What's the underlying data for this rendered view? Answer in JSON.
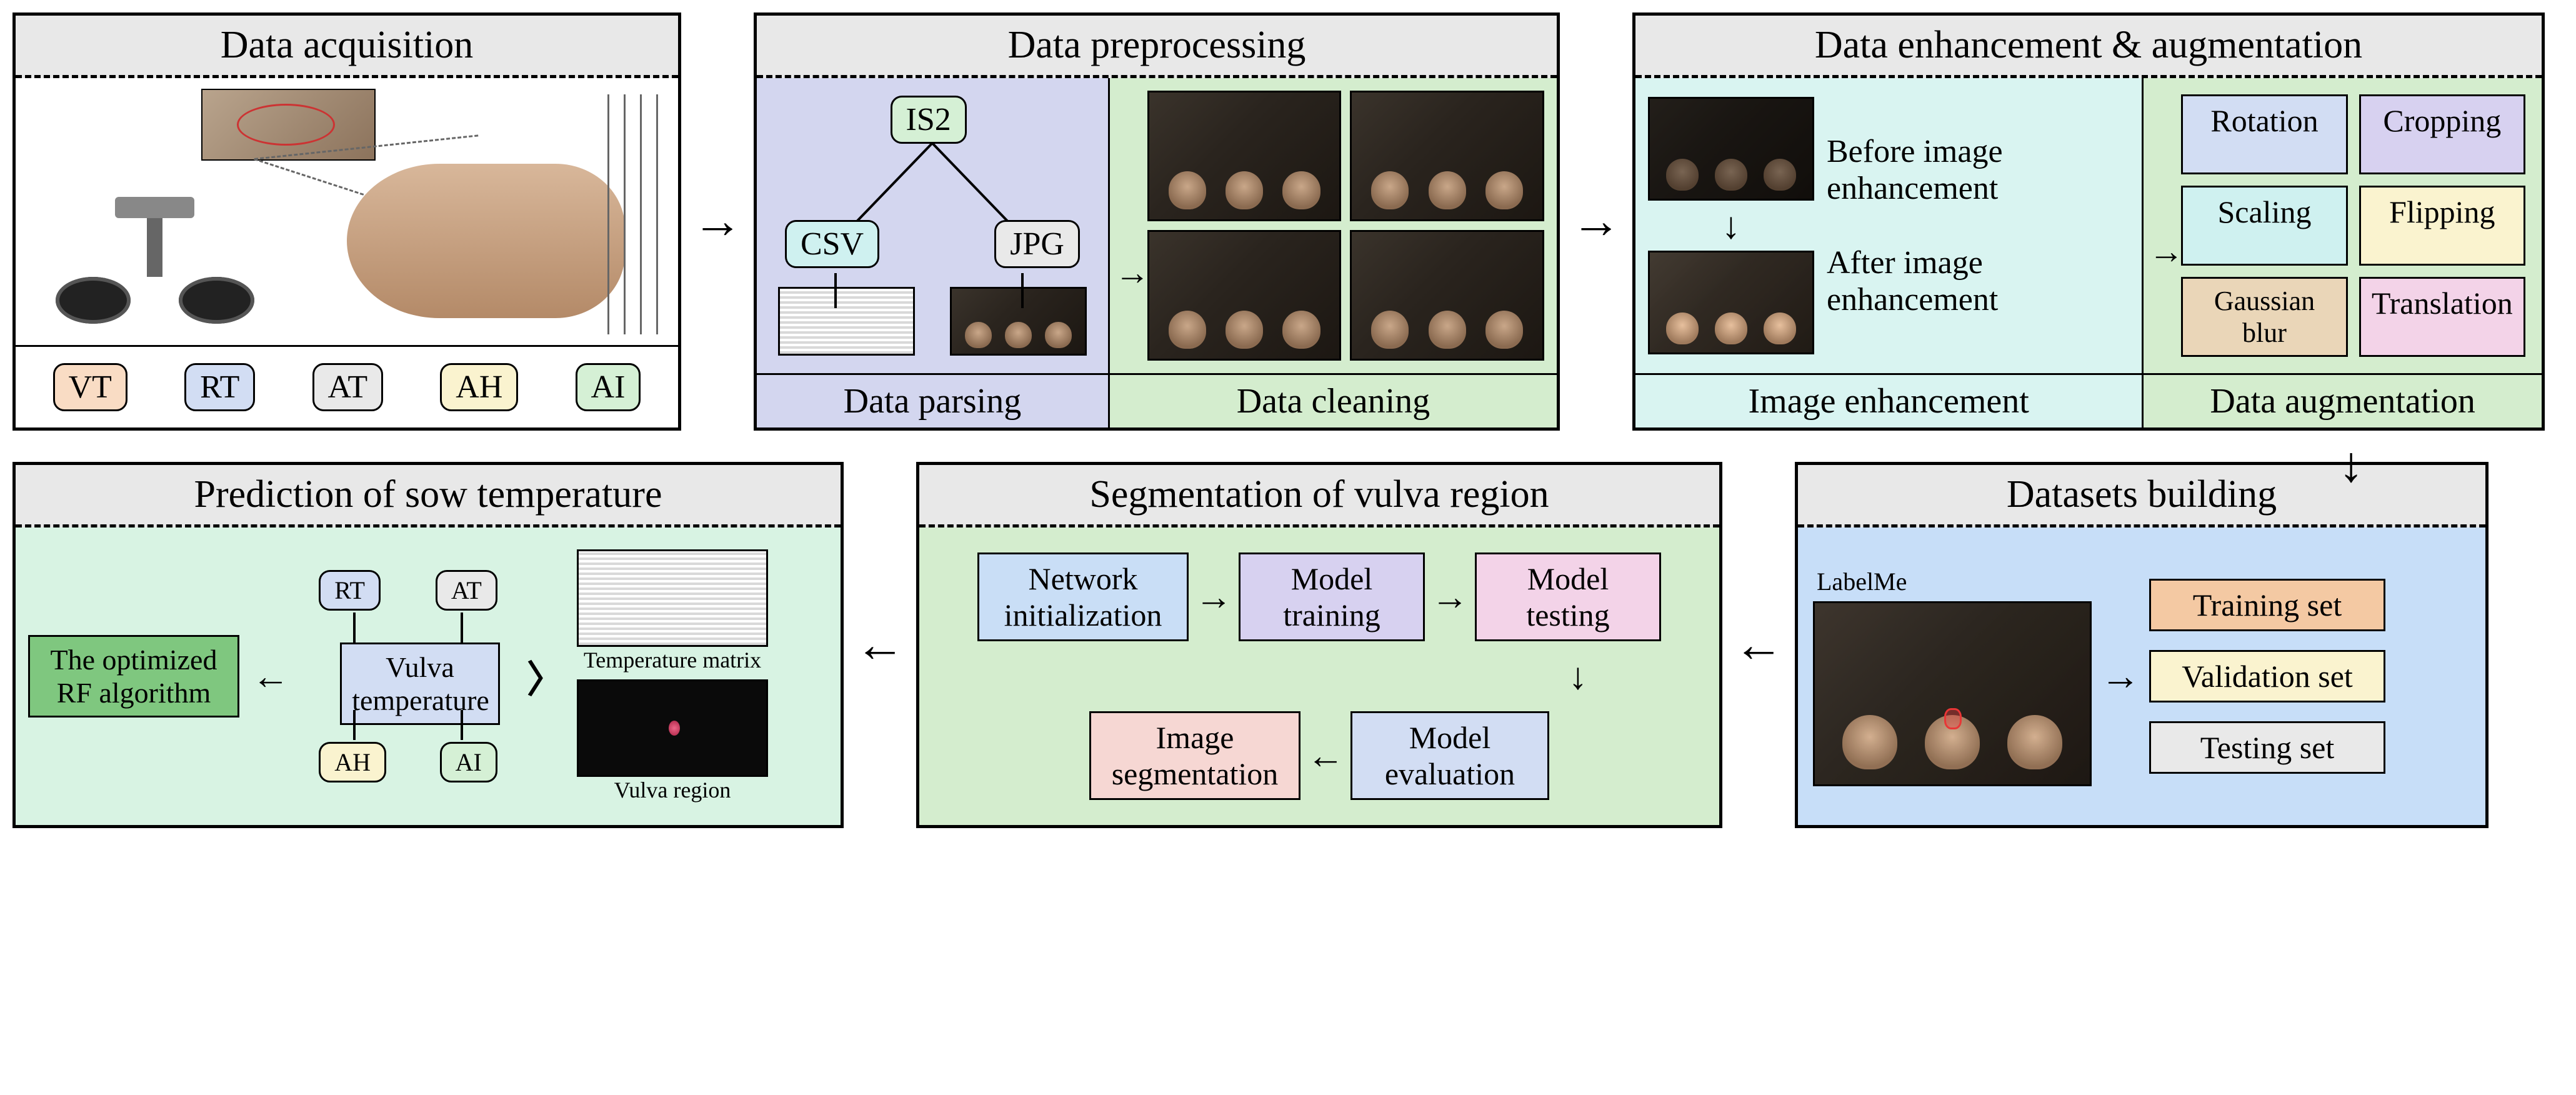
{
  "p1": {
    "title": "Data acquisition",
    "tags": [
      "VT",
      "RT",
      "AT",
      "AH",
      "AI"
    ]
  },
  "p2": {
    "title": "Data preprocessing",
    "nodes": {
      "is2": "IS2",
      "csv": "CSV",
      "jpg": "JPG"
    },
    "sub": {
      "parse": "Data parsing",
      "clean": "Data cleaning"
    }
  },
  "p3": {
    "title": "Data enhancement & augmentation",
    "before": "Before image enhancement",
    "after": "After image enhancement",
    "ops": [
      "Rotation",
      "Cropping",
      "Scaling",
      "Flipping",
      "Gaussian blur",
      "Translation"
    ],
    "sub": {
      "enh": "Image enhancement",
      "aug": "Data augmentation"
    }
  },
  "p4": {
    "title": "Datasets building",
    "tool": "LabelMe",
    "sets": [
      "Training set",
      "Validation set",
      "Testing set"
    ]
  },
  "p5": {
    "title": "Segmentation of vulva region",
    "steps": {
      "init": "Network initialization",
      "train": "Model training",
      "test": "Model testing",
      "eval": "Model evaluation",
      "seg": "Image segmentation"
    }
  },
  "p6": {
    "title": "Prediction of sow  temperature",
    "rf": "The optimized RF algorithm",
    "center": "Vulva temperature",
    "inputs": [
      "RT",
      "AT",
      "AH",
      "AI"
    ],
    "matlabel": "Temperature matrix",
    "reglabel": "Vulva region"
  }
}
